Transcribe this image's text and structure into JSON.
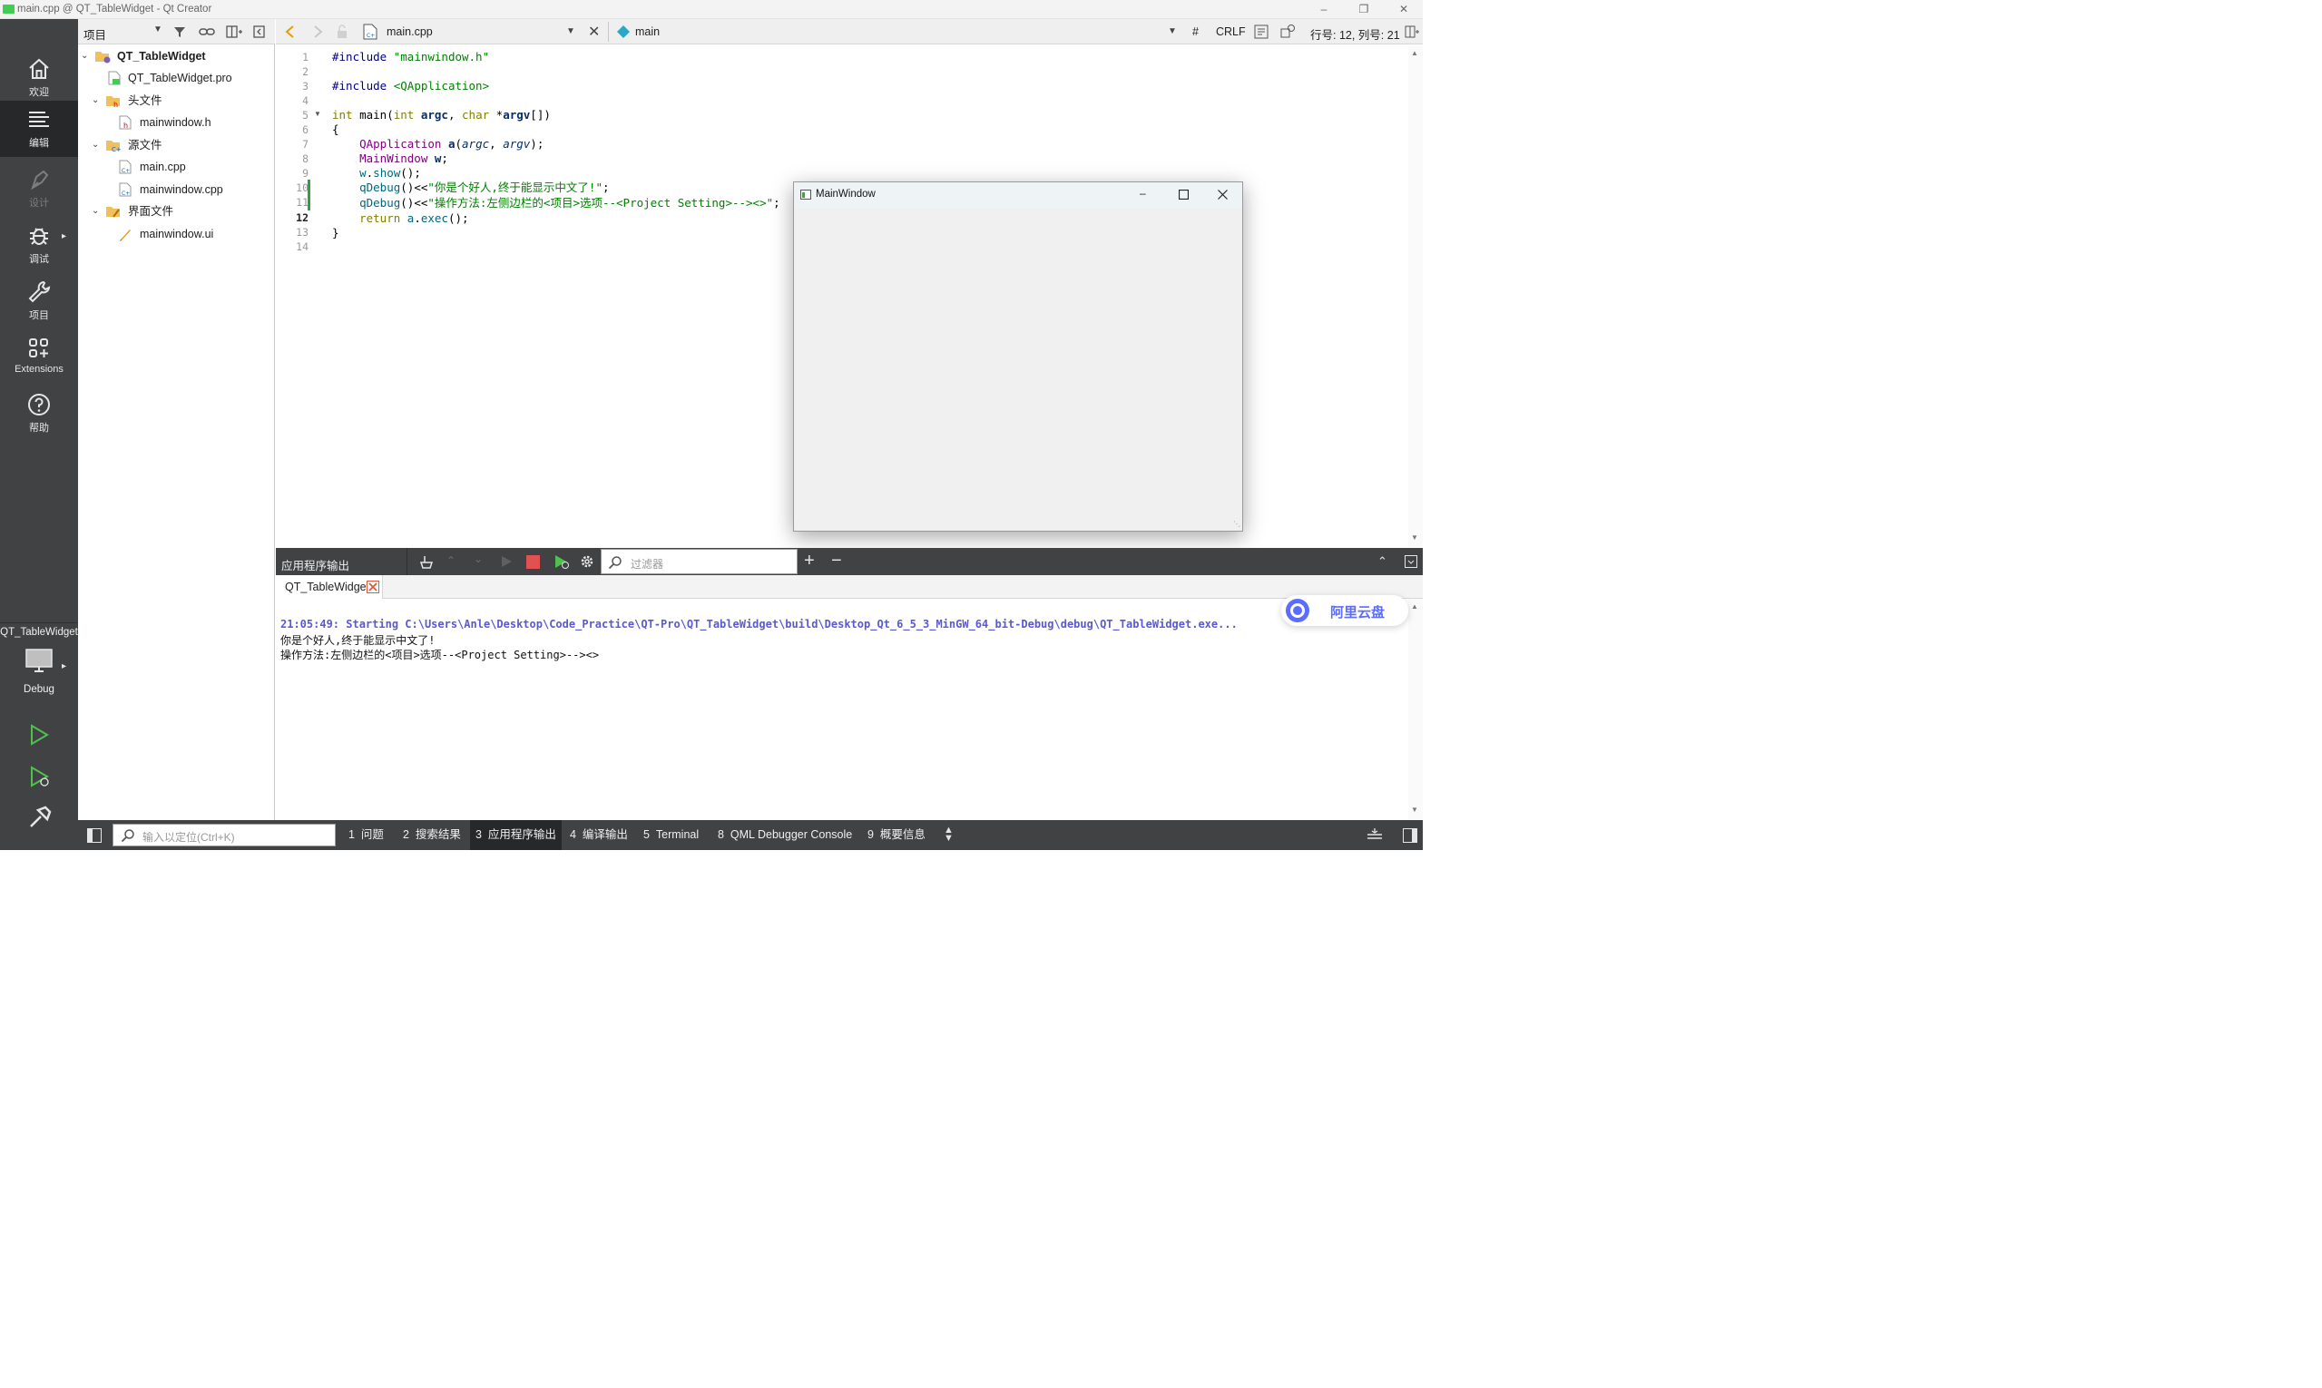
{
  "window": {
    "title": "main.cpp @ QT_TableWidget - Qt Creator"
  },
  "modes": [
    {
      "label": "欢迎"
    },
    {
      "label": "编辑"
    },
    {
      "label": "设计"
    },
    {
      "label": "调试"
    },
    {
      "label": "项目"
    },
    {
      "label": "Extensions"
    },
    {
      "label": "帮助"
    }
  ],
  "kit": {
    "project": "QT_TableWidget",
    "config": "Debug"
  },
  "tree_header": {
    "selector": "项目"
  },
  "tree": {
    "root": "QT_TableWidget",
    "pro_file": "QT_TableWidget.pro",
    "headers_group": "头文件",
    "header_file": "mainwindow.h",
    "sources_group": "源文件",
    "source_1": "main.cpp",
    "source_2": "mainwindow.cpp",
    "forms_group": "界面文件",
    "form_file": "mainwindow.ui"
  },
  "editor_bar": {
    "file": "main.cpp",
    "symbol": "main",
    "hash": "#",
    "line_ending": "CRLF",
    "position": "行号: 12, 列号: 21"
  },
  "editor": {
    "line_numbers": [
      "1",
      "2",
      "3",
      "4",
      "5",
      "6",
      "7",
      "8",
      "9",
      "10",
      "11",
      "12",
      "13",
      "14"
    ],
    "current_line": 12
  },
  "code": {
    "l1_directive": "#include",
    "l1_file": " \"mainwindow.h\"",
    "l3_directive": "#include",
    "l3_file": " <QApplication>",
    "l5_int": "int",
    "l5_main": " main(",
    "l5_int2": "int",
    "l5_argc": " argc",
    "l5_comma": ", ",
    "l5_char": "char",
    "l5_star": " *",
    "l5_argv": "argv",
    "l5_end": "[])",
    "l6": "{",
    "l7_type": "    QApplication",
    "l7_a": " a",
    "l7_open": "(",
    "l7_argc": "argc",
    "l7_comma": ", ",
    "l7_argv": "argv",
    "l7_end": ");",
    "l8_type": "    MainWindow",
    "l8_w": " w",
    "l8_end": ";",
    "l9_w": "    w",
    "l9_dot": ".",
    "l9_show": "show",
    "l9_end": "();",
    "l10_fn": "    qDebug",
    "l10_op": "()<<",
    "l10_str": "\"你是个好人,终于能显示中文了!\"",
    "l10_end": ";",
    "l11_fn": "    qDebug",
    "l11_op": "()<<",
    "l11_str": "\"操作方法:左侧边栏的<项目>选项--<Project Setting>--><>\"",
    "l11_end": ";",
    "l12_return": "    return",
    "l12_a": " a",
    "l12_dot": ".",
    "l12_exec": "exec",
    "l12_end": "();",
    "l13": "}"
  },
  "app_window": {
    "title": "MainWindow"
  },
  "output": {
    "pane_title": "应用程序输出",
    "filter_placeholder": "过滤器",
    "tab": "QT_TableWidget",
    "start_line": "21:05:49: Starting C:\\Users\\Anle\\Desktop\\Code_Practice\\QT-Pro\\QT_TableWidget\\build\\Desktop_Qt_6_5_3_MinGW_64_bit-Debug\\debug\\QT_TableWidget.exe...",
    "line_1": "你是个好人,终于能显示中文了!",
    "line_2": "操作方法:左侧边栏的<项目>选项--<Project Setting>--><>",
    "start_color": "#5a5ad0"
  },
  "status": {
    "locator_placeholder": "输入以定位(Ctrl+K)",
    "tabs": [
      {
        "num": "1",
        "label": "问题"
      },
      {
        "num": "2",
        "label": "搜索结果"
      },
      {
        "num": "3",
        "label": "应用程序输出"
      },
      {
        "num": "4",
        "label": "编译输出"
      },
      {
        "num": "5",
        "label": "Terminal"
      },
      {
        "num": "8",
        "label": "QML Debugger Console"
      },
      {
        "num": "9",
        "label": "概要信息"
      }
    ]
  },
  "overlay": {
    "aliyun": "阿里云盘"
  },
  "colors": {
    "accent_green": "#41cd52",
    "modebar": "#404244",
    "active_mode": "#262829"
  }
}
